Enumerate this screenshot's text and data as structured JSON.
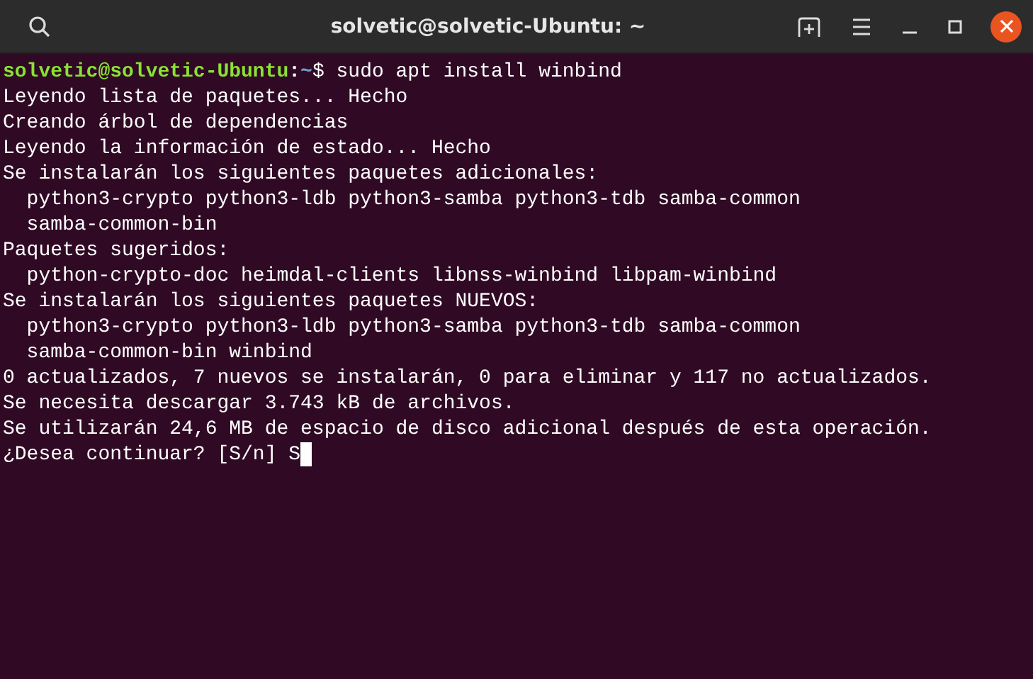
{
  "window": {
    "title": "solvetic@solvetic-Ubuntu: ~"
  },
  "terminal": {
    "lines": [
      {
        "kind": "prompt",
        "user_host": "solvetic@solvetic-Ubuntu",
        "separator": ":",
        "path": "~",
        "symbol": "$",
        "command": "sudo apt install winbind"
      },
      {
        "kind": "output",
        "indent": false,
        "text": "Leyendo lista de paquetes... Hecho"
      },
      {
        "kind": "output",
        "indent": false,
        "text": "Creando árbol de dependencias"
      },
      {
        "kind": "output",
        "indent": false,
        "text": "Leyendo la información de estado... Hecho"
      },
      {
        "kind": "output",
        "indent": false,
        "text": "Se instalarán los siguientes paquetes adicionales:"
      },
      {
        "kind": "output",
        "indent": true,
        "text": "python3-crypto python3-ldb python3-samba python3-tdb samba-common"
      },
      {
        "kind": "output",
        "indent": true,
        "text": "samba-common-bin"
      },
      {
        "kind": "output",
        "indent": false,
        "text": "Paquetes sugeridos:"
      },
      {
        "kind": "output",
        "indent": true,
        "text": "python-crypto-doc heimdal-clients libnss-winbind libpam-winbind"
      },
      {
        "kind": "output",
        "indent": false,
        "text": "Se instalarán los siguientes paquetes NUEVOS:"
      },
      {
        "kind": "output",
        "indent": true,
        "text": "python3-crypto python3-ldb python3-samba python3-tdb samba-common"
      },
      {
        "kind": "output",
        "indent": true,
        "text": "samba-common-bin winbind"
      },
      {
        "kind": "output",
        "indent": false,
        "text": "0 actualizados, 7 nuevos se instalarán, 0 para eliminar y 117 no actualizados."
      },
      {
        "kind": "output",
        "indent": false,
        "text": "Se necesita descargar 3.743 kB de archivos."
      },
      {
        "kind": "output",
        "indent": false,
        "text": "Se utilizarán 24,6 MB de espacio de disco adicional después de esta operación."
      },
      {
        "kind": "input",
        "question": "¿Desea continuar? [S/n]",
        "value": "S"
      }
    ]
  }
}
